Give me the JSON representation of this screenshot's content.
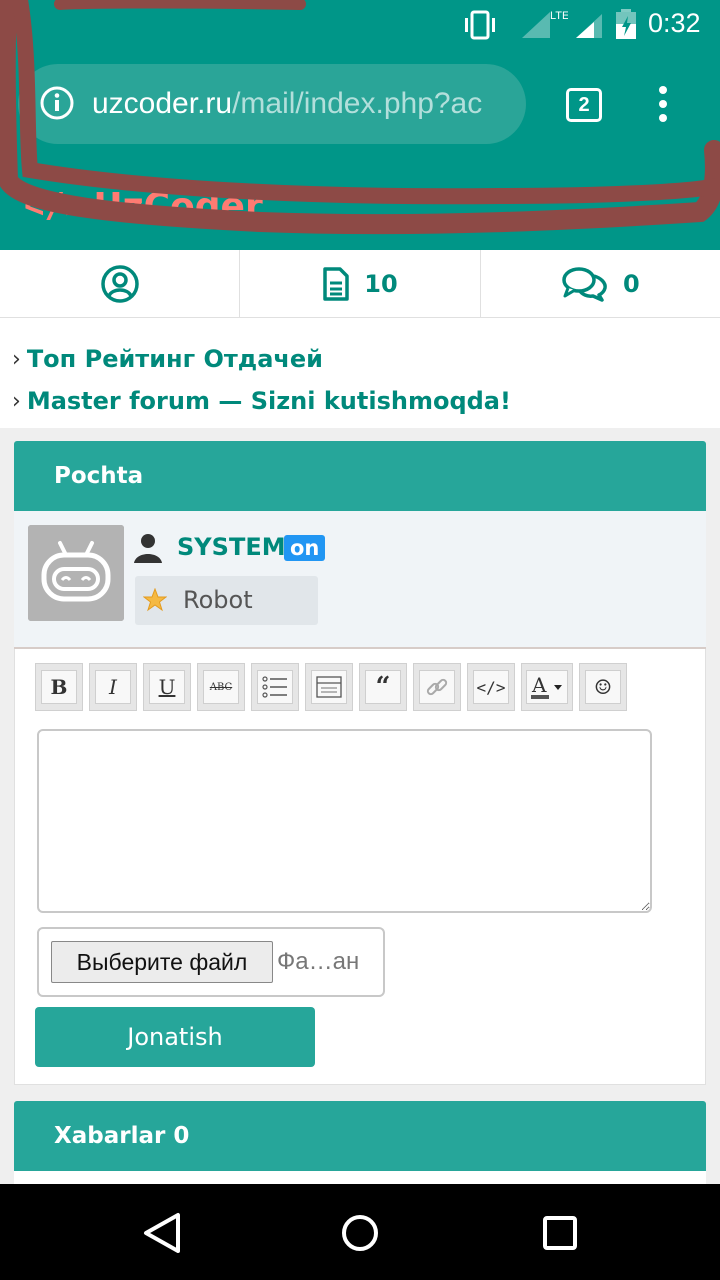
{
  "status_bar": {
    "time": "0:32",
    "network": "LTE",
    "icons": [
      "vibrate-icon",
      "signal-icon",
      "battery-icon"
    ]
  },
  "browser": {
    "url_host": "uzcoder.ru",
    "url_path": "/mail/index.php?ac",
    "tab_count": "2"
  },
  "site": {
    "logo_icon": "</>",
    "logo_text": "UzCoder",
    "accent_color": "#26a69a",
    "logo_color": "#ff7b72"
  },
  "nav": {
    "profile_icon": "user-circle-icon",
    "docs_icon": "document-icon",
    "docs_count": "10",
    "chat_icon": "chat-bubbles-icon",
    "chat_count": "0"
  },
  "links": [
    {
      "chevron": "›",
      "label": "Топ Рейтинг Отдачей"
    },
    {
      "chevron": "›",
      "label": "Master forum — Sizni kutishmoqda!"
    }
  ],
  "mail": {
    "title": "Pochta",
    "user": {
      "name": "SYSTEM",
      "status": "on",
      "role": "Robot"
    },
    "toolbar": [
      {
        "name": "bold-button",
        "glyph": "B"
      },
      {
        "name": "italic-button",
        "glyph": "I"
      },
      {
        "name": "underline-button",
        "glyph": "U"
      },
      {
        "name": "strike-button",
        "glyph": "ABC"
      },
      {
        "name": "list-button",
        "glyph": "list"
      },
      {
        "name": "spoiler-button",
        "glyph": "block"
      },
      {
        "name": "quote-button",
        "glyph": "“"
      },
      {
        "name": "link-button",
        "glyph": "link"
      },
      {
        "name": "code-button",
        "glyph": "</>"
      },
      {
        "name": "color-button",
        "glyph": "A"
      },
      {
        "name": "smile-button",
        "glyph": "☺"
      }
    ],
    "message_value": "",
    "file_button": "Выберите файл",
    "file_status": "Фа…ан",
    "send_label": "Jonatish"
  },
  "messages": {
    "title": "Xabarlar 0"
  }
}
